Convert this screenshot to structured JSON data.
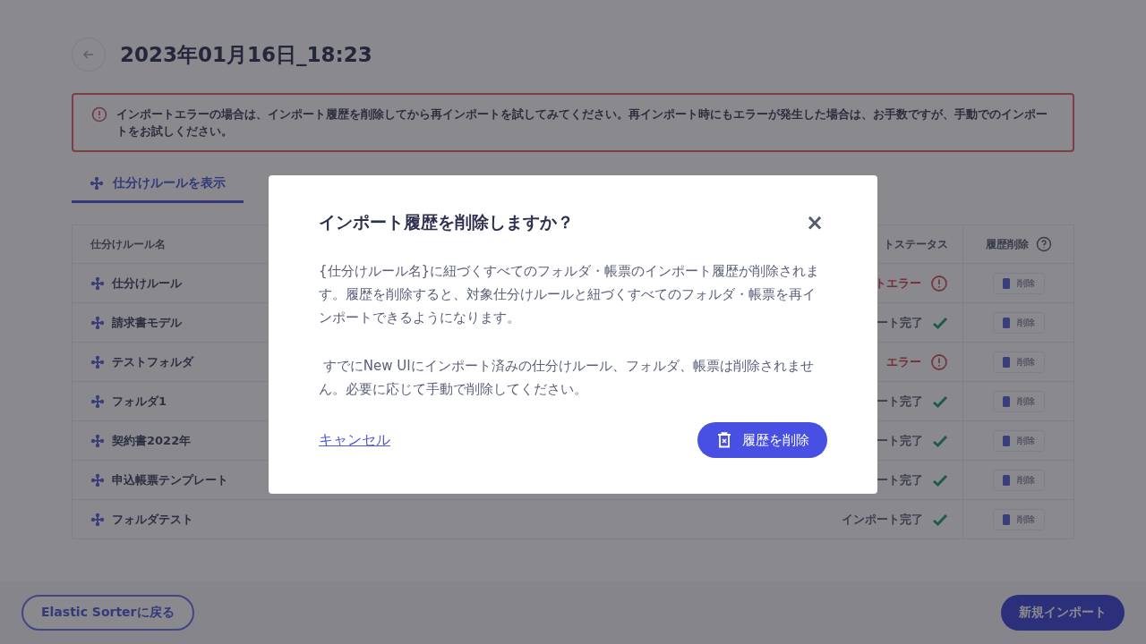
{
  "page": {
    "title": "2023年01月16日_18:23"
  },
  "alert": {
    "text": "インポートエラーの場合は、インポート履歴を削除してから再インポートを試してみてください。再インポート時にもエラーが発生した場合は、お手数ですが、手動でのインポートをお試しください。"
  },
  "tabs": [
    {
      "label": "仕分けルールを表示",
      "selected": true
    }
  ],
  "table": {
    "columns": [
      "仕分けルール名",
      "トステータス",
      "履歴削除"
    ],
    "rows": [
      {
        "name": "仕分けルール",
        "status": "トエラー",
        "kind": "error",
        "action": "削除"
      },
      {
        "name": "請求書モデル",
        "status": "ート完了",
        "kind": "done",
        "action": "削除"
      },
      {
        "name": "テストフォルダ",
        "status": "エラー",
        "kind": "error",
        "action": "削除"
      },
      {
        "name": "フォルダ1",
        "status": "ート完了",
        "kind": "done",
        "action": "削除"
      },
      {
        "name": "契約書2022年",
        "status": "ート完了",
        "kind": "done",
        "action": "削除"
      },
      {
        "name": "申込帳票テンプレート",
        "status": "ート完了",
        "kind": "done",
        "action": "削除"
      },
      {
        "name": "フォルダテスト",
        "status": "インポート完了",
        "kind": "done",
        "action": "削除"
      }
    ]
  },
  "footer": {
    "back_button": "Elastic Sorterに戻る",
    "primary_button": "新規インポート"
  },
  "dialog": {
    "title": "インポート履歴を削除しますか？",
    "close": "×",
    "paragraphs": [
      "{仕分けルール名}に紐づくすべてのフォルダ・帳票のインポート履歴が削除されます。履歴を削除すると、対象仕分けルールと紐づくすべてのフォルダ・帳票を再インポートできるようになります。",
      " すでにNew UIにインポート済みの仕分けルール、フォルダ、帳票は削除されません。必要に応じて手動で削除してください。"
    ],
    "cancel": "キャンセル",
    "confirm": "履歴を削除"
  }
}
